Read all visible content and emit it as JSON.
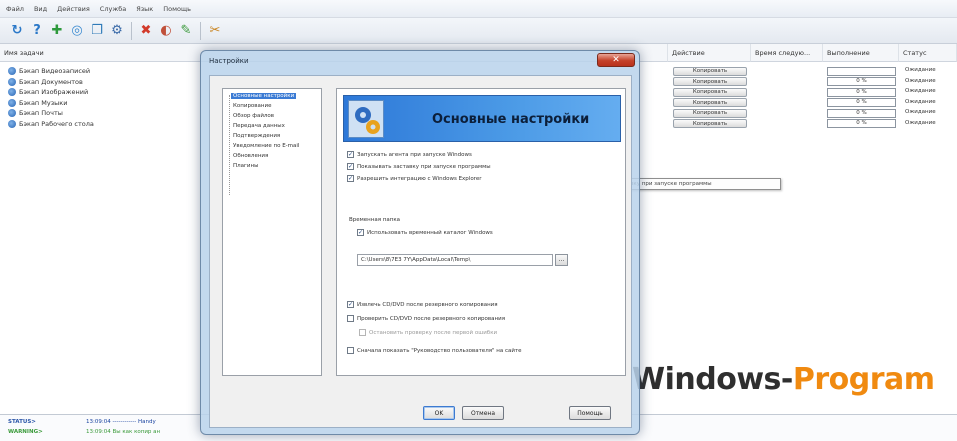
{
  "menu": [
    "Файл",
    "Вид",
    "Действия",
    "Служба",
    "Язык",
    "Помощь"
  ],
  "toolbar": {
    "buttons": [
      {
        "name": "refresh-icon",
        "glyph": "↻",
        "color": "#2a78c8"
      },
      {
        "name": "help-icon",
        "glyph": "?",
        "color": "#2a78c8"
      },
      {
        "name": "add-icon",
        "glyph": "✚",
        "color": "#2e9a3c"
      },
      {
        "name": "circle-icon",
        "glyph": "◎",
        "color": "#3a8ad0"
      },
      {
        "name": "copy-icon",
        "glyph": "❐",
        "color": "#2e7ab8"
      },
      {
        "name": "settings-icon",
        "glyph": "⚙",
        "color": "#3a6aa8"
      },
      {
        "name": "delete-icon",
        "glyph": "✖",
        "color": "#d23a2a"
      },
      {
        "name": "schedule-icon",
        "glyph": "◐",
        "color": "#c0503a"
      },
      {
        "name": "edit-icon",
        "glyph": "✎",
        "color": "#3c9a3c"
      },
      {
        "name": "tools-icon",
        "glyph": "✂",
        "color": "#c8821e"
      }
    ]
  },
  "columns": [
    "Имя задачи",
    "Действие",
    "Время следую...",
    "Выполнение",
    "Статус"
  ],
  "tasks": [
    {
      "name": "Бэкап Видеозаписей",
      "action": "Копировать",
      "progress": "",
      "status": "Ожидание"
    },
    {
      "name": "Бэкап Документов",
      "action": "Копировать",
      "progress": "0 %",
      "status": "Ожидание"
    },
    {
      "name": "Бэкап Изображений",
      "action": "Копировать",
      "progress": "0 %",
      "status": "Ожидание"
    },
    {
      "name": "Бэкап Музыки",
      "action": "Копировать",
      "progress": "0 %",
      "status": "Ожидание"
    },
    {
      "name": "Бэкап Почты",
      "action": "Копировать",
      "progress": "0 %",
      "status": "Ожидание"
    },
    {
      "name": "Бэкап Рабочего стола",
      "action": "Копировать",
      "progress": "0 %",
      "status": "Ожидание"
    }
  ],
  "log": [
    {
      "key": "STATUS>",
      "text": "13:09:04 ------------ Handy"
    },
    {
      "key": "WARNING>",
      "text": "13:09:04 Вы как копир ан"
    }
  ],
  "tooltip": "Показывать заставку при запуске программы",
  "watermark": {
    "part1": "Windows-",
    "part2": "Program"
  },
  "dialog": {
    "title": "Настройки",
    "close": "✕",
    "nav": [
      "Основные настройки",
      "Копирование",
      "Обзор файлов",
      "Передача данных",
      "Подтверждения",
      "Уведомление по E-mail",
      "Обновления",
      "Плагины"
    ],
    "banner_title": "Основные настройки",
    "checkboxes": [
      {
        "label": "Запускать агента при запуске Windows",
        "checked": "✓"
      },
      {
        "label": "Показывать заставку при запуске программы",
        "checked": "✓"
      },
      {
        "label": "Разрешить интеграцию с Windows Explorer",
        "checked": "✓"
      }
    ],
    "temp_group": "Временная папка",
    "temp_use": {
      "label": "Использовать временный каталог Windows",
      "checked": "✓"
    },
    "temp_path": "C:\\Users\\8\\7E3 7Y\\AppData\\Local\\Temp\\",
    "browse": "...",
    "verify": [
      {
        "label": "Извлечь CD/DVD после резервного копирования",
        "checked": "✓"
      },
      {
        "label": "Проверить CD/DVD после резервного копирования",
        "checked": ""
      },
      {
        "label": "Остановить проверку после первой ошибки",
        "checked": ""
      },
      {
        "label": "Сначала показать \"Руководство пользователя\" на сайте",
        "checked": ""
      }
    ],
    "buttons": {
      "ok": "OK",
      "cancel": "Отмена",
      "help": "Помощь"
    }
  }
}
